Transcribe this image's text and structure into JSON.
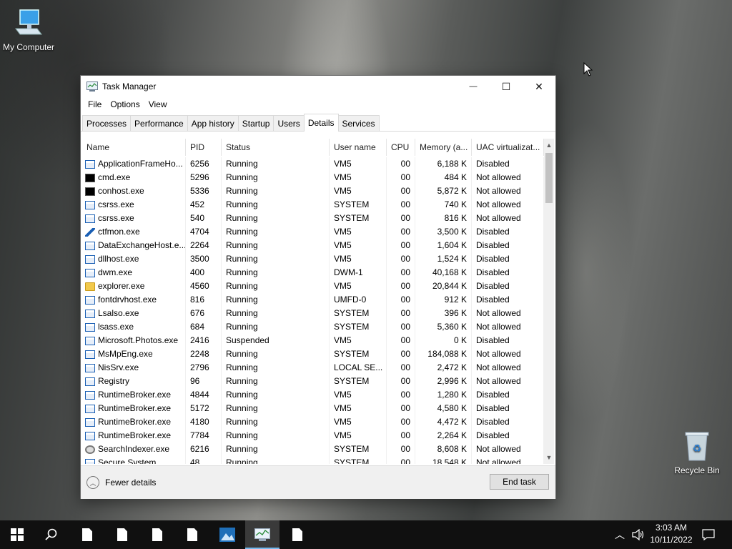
{
  "desktop": {
    "icons": [
      {
        "label": "My Computer"
      },
      {
        "label": "Recycle Bin"
      }
    ]
  },
  "window": {
    "title": "Task Manager",
    "controls": {
      "minimize": "—",
      "maximize": "☐",
      "close": "✕"
    },
    "menu": [
      "File",
      "Options",
      "View"
    ],
    "tabs": [
      "Processes",
      "Performance",
      "App history",
      "Startup",
      "Users",
      "Details",
      "Services"
    ],
    "active_tab": "Details",
    "columns": [
      "Name",
      "PID",
      "Status",
      "User name",
      "CPU",
      "Memory (a...",
      "UAC virtualizat..."
    ],
    "rows": [
      {
        "icon": "app",
        "name": "ApplicationFrameHo...",
        "pid": "6256",
        "status": "Running",
        "user": "VM5",
        "cpu": "00",
        "mem": "6,188 K",
        "uac": "Disabled"
      },
      {
        "icon": "cmd",
        "name": "cmd.exe",
        "pid": "5296",
        "status": "Running",
        "user": "VM5",
        "cpu": "00",
        "mem": "484 K",
        "uac": "Not allowed"
      },
      {
        "icon": "cmd",
        "name": "conhost.exe",
        "pid": "5336",
        "status": "Running",
        "user": "VM5",
        "cpu": "00",
        "mem": "5,872 K",
        "uac": "Not allowed"
      },
      {
        "icon": "app",
        "name": "csrss.exe",
        "pid": "452",
        "status": "Running",
        "user": "SYSTEM",
        "cpu": "00",
        "mem": "740 K",
        "uac": "Not allowed"
      },
      {
        "icon": "app",
        "name": "csrss.exe",
        "pid": "540",
        "status": "Running",
        "user": "SYSTEM",
        "cpu": "00",
        "mem": "816 K",
        "uac": "Not allowed"
      },
      {
        "icon": "pen",
        "name": "ctfmon.exe",
        "pid": "4704",
        "status": "Running",
        "user": "VM5",
        "cpu": "00",
        "mem": "3,500 K",
        "uac": "Disabled"
      },
      {
        "icon": "app",
        "name": "DataExchangeHost.e...",
        "pid": "2264",
        "status": "Running",
        "user": "VM5",
        "cpu": "00",
        "mem": "1,604 K",
        "uac": "Disabled"
      },
      {
        "icon": "app",
        "name": "dllhost.exe",
        "pid": "3500",
        "status": "Running",
        "user": "VM5",
        "cpu": "00",
        "mem": "1,524 K",
        "uac": "Disabled"
      },
      {
        "icon": "app",
        "name": "dwm.exe",
        "pid": "400",
        "status": "Running",
        "user": "DWM-1",
        "cpu": "00",
        "mem": "40,168 K",
        "uac": "Disabled"
      },
      {
        "icon": "folder",
        "name": "explorer.exe",
        "pid": "4560",
        "status": "Running",
        "user": "VM5",
        "cpu": "00",
        "mem": "20,844 K",
        "uac": "Disabled"
      },
      {
        "icon": "app",
        "name": "fontdrvhost.exe",
        "pid": "816",
        "status": "Running",
        "user": "UMFD-0",
        "cpu": "00",
        "mem": "912 K",
        "uac": "Disabled"
      },
      {
        "icon": "app",
        "name": "Lsalso.exe",
        "pid": "676",
        "status": "Running",
        "user": "SYSTEM",
        "cpu": "00",
        "mem": "396 K",
        "uac": "Not allowed"
      },
      {
        "icon": "app",
        "name": "lsass.exe",
        "pid": "684",
        "status": "Running",
        "user": "SYSTEM",
        "cpu": "00",
        "mem": "5,360 K",
        "uac": "Not allowed"
      },
      {
        "icon": "app",
        "name": "Microsoft.Photos.exe",
        "pid": "2416",
        "status": "Suspended",
        "user": "VM5",
        "cpu": "00",
        "mem": "0 K",
        "uac": "Disabled"
      },
      {
        "icon": "app",
        "name": "MsMpEng.exe",
        "pid": "2248",
        "status": "Running",
        "user": "SYSTEM",
        "cpu": "00",
        "mem": "184,088 K",
        "uac": "Not allowed"
      },
      {
        "icon": "app",
        "name": "NisSrv.exe",
        "pid": "2796",
        "status": "Running",
        "user": "LOCAL SE...",
        "cpu": "00",
        "mem": "2,472 K",
        "uac": "Not allowed"
      },
      {
        "icon": "app",
        "name": "Registry",
        "pid": "96",
        "status": "Running",
        "user": "SYSTEM",
        "cpu": "00",
        "mem": "2,996 K",
        "uac": "Not allowed"
      },
      {
        "icon": "app",
        "name": "RuntimeBroker.exe",
        "pid": "4844",
        "status": "Running",
        "user": "VM5",
        "cpu": "00",
        "mem": "1,280 K",
        "uac": "Disabled"
      },
      {
        "icon": "app",
        "name": "RuntimeBroker.exe",
        "pid": "5172",
        "status": "Running",
        "user": "VM5",
        "cpu": "00",
        "mem": "4,580 K",
        "uac": "Disabled"
      },
      {
        "icon": "app",
        "name": "RuntimeBroker.exe",
        "pid": "4180",
        "status": "Running",
        "user": "VM5",
        "cpu": "00",
        "mem": "4,472 K",
        "uac": "Disabled"
      },
      {
        "icon": "app",
        "name": "RuntimeBroker.exe",
        "pid": "7784",
        "status": "Running",
        "user": "VM5",
        "cpu": "00",
        "mem": "2,264 K",
        "uac": "Disabled"
      },
      {
        "icon": "search",
        "name": "SearchIndexer.exe",
        "pid": "6216",
        "status": "Running",
        "user": "SYSTEM",
        "cpu": "00",
        "mem": "8,608 K",
        "uac": "Not allowed"
      },
      {
        "icon": "app",
        "name": "Secure System",
        "pid": "48",
        "status": "Running",
        "user": "SYSTEM",
        "cpu": "00",
        "mem": "18,548 K",
        "uac": "Not allowed"
      }
    ],
    "footer": {
      "fewer_details": "Fewer details",
      "end_task": "End task"
    }
  },
  "taskbar": {
    "clock": {
      "time": "3:03 AM",
      "date": "10/11/2022"
    },
    "accent_color": "#76b9ed"
  }
}
